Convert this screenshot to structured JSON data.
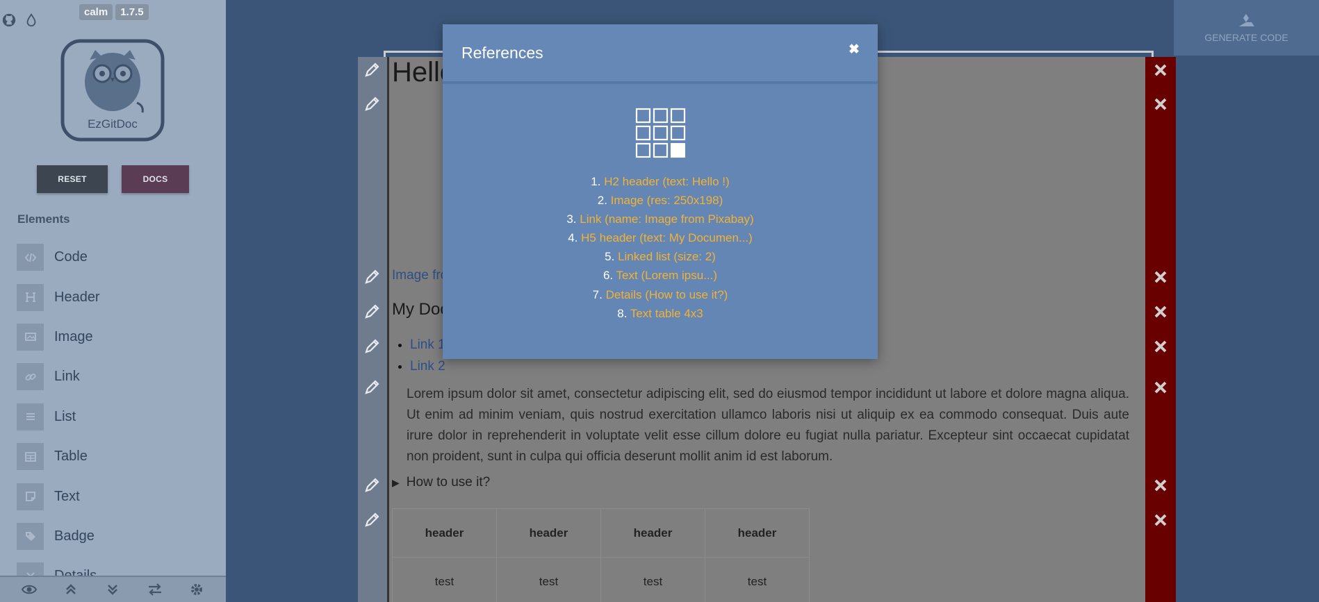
{
  "app": {
    "theme_tag": "calm",
    "version_tag": "1.7.5",
    "logo_text": "EzGitDoc"
  },
  "sidebar": {
    "reset_label": "RESET",
    "docs_label": "DOCS",
    "elements_title": "Elements",
    "items": [
      {
        "label": "Code",
        "icon": "code-icon"
      },
      {
        "label": "Header",
        "icon": "header-icon"
      },
      {
        "label": "Image",
        "icon": "image-icon"
      },
      {
        "label": "Link",
        "icon": "link-icon"
      },
      {
        "label": "List",
        "icon": "list-icon"
      },
      {
        "label": "Table",
        "icon": "table-icon"
      },
      {
        "label": "Text",
        "icon": "text-icon"
      },
      {
        "label": "Badge",
        "icon": "badge-icon"
      },
      {
        "label": "Details",
        "icon": "details-icon"
      }
    ],
    "bottom_icons": [
      "eye-icon",
      "collapse-up-icon",
      "expand-down-icon",
      "swap-icon",
      "gear-icon"
    ]
  },
  "generate": {
    "label": "GENERATE CODE"
  },
  "editor": {
    "h2_text": "Hello !",
    "link_text": "Image from Pixabay",
    "h5_text": "My Documentation",
    "list_items": [
      "Link 1",
      "Link 2"
    ],
    "paragraph": "Lorem ipsum dolor sit amet, consectetur adipiscing elit, sed do eiusmod tempor incididunt ut labore et dolore magna aliqua. Ut enim ad minim veniam, quis nostrud exercitation ullamco laboris nisi ut aliquip ex ea commodo consequat. Duis aute irure dolor in reprehenderit in voluptate velit esse cillum dolore eu fugiat nulla pariatur. Excepteur sint occaecat cupidatat non proident, sunt in culpa qui officia deserunt mollit anim id est laborum.",
    "details_summary": "How to use it?",
    "table": {
      "headers": [
        "header",
        "header",
        "header",
        "header"
      ],
      "row": [
        "test",
        "test",
        "test",
        "test"
      ]
    }
  },
  "modal": {
    "title": "References",
    "close_symbol": "✖",
    "references": [
      {
        "num": "1.",
        "text": "H2 header (text: Hello !)"
      },
      {
        "num": "2.",
        "text": "Image (res: 250x198)"
      },
      {
        "num": "3.",
        "text": "Link (name: Image from Pixabay)"
      },
      {
        "num": "4.",
        "text": "H5 header (text: My Documen...)"
      },
      {
        "num": "5.",
        "text": "Linked list (size: 2)"
      },
      {
        "num": "6.",
        "text": "Text (Lorem ipsu...)"
      },
      {
        "num": "7.",
        "text": "Details (How to use it?)"
      },
      {
        "num": "8.",
        "text": "Text table 4x3"
      }
    ]
  },
  "colors": {
    "accent_orange": "#f3b233",
    "modal_bg": "#6486b4",
    "delete_gutter": "#680000"
  }
}
